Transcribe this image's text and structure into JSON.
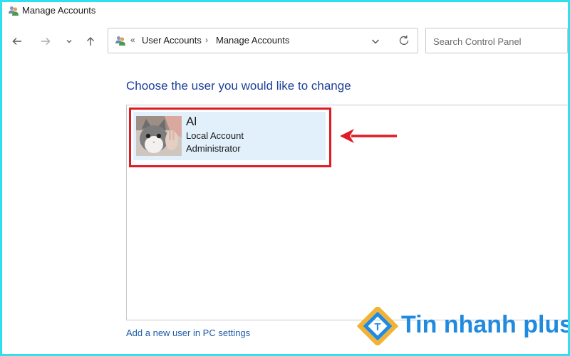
{
  "window": {
    "title": "Manage Accounts"
  },
  "nav": {
    "back_icon": "arrow-left-icon",
    "forward_icon": "arrow-right-icon",
    "recent_icon": "chevron-down-icon",
    "up_icon": "arrow-up-icon"
  },
  "address": {
    "overflow": "«",
    "crumbs": [
      "User Accounts",
      "Manage Accounts"
    ],
    "separator": "›"
  },
  "search": {
    "placeholder": "Search Control Panel"
  },
  "main": {
    "heading": "Choose the user you would like to change",
    "users": [
      {
        "name": "Al",
        "account_type": "Local Account",
        "role": "Administrator"
      }
    ],
    "add_user_link": "Add a new user in PC settings"
  },
  "watermark": {
    "text": "Tin nhanh plus",
    "logo_letter": "T"
  },
  "colors": {
    "frame": "#2fe0ee",
    "heading": "#1e3f9a",
    "link": "#1e5aa8",
    "tile_selected": "#e1f0fb",
    "highlight": "#e01b24",
    "watermark": "#1f8ae0"
  }
}
